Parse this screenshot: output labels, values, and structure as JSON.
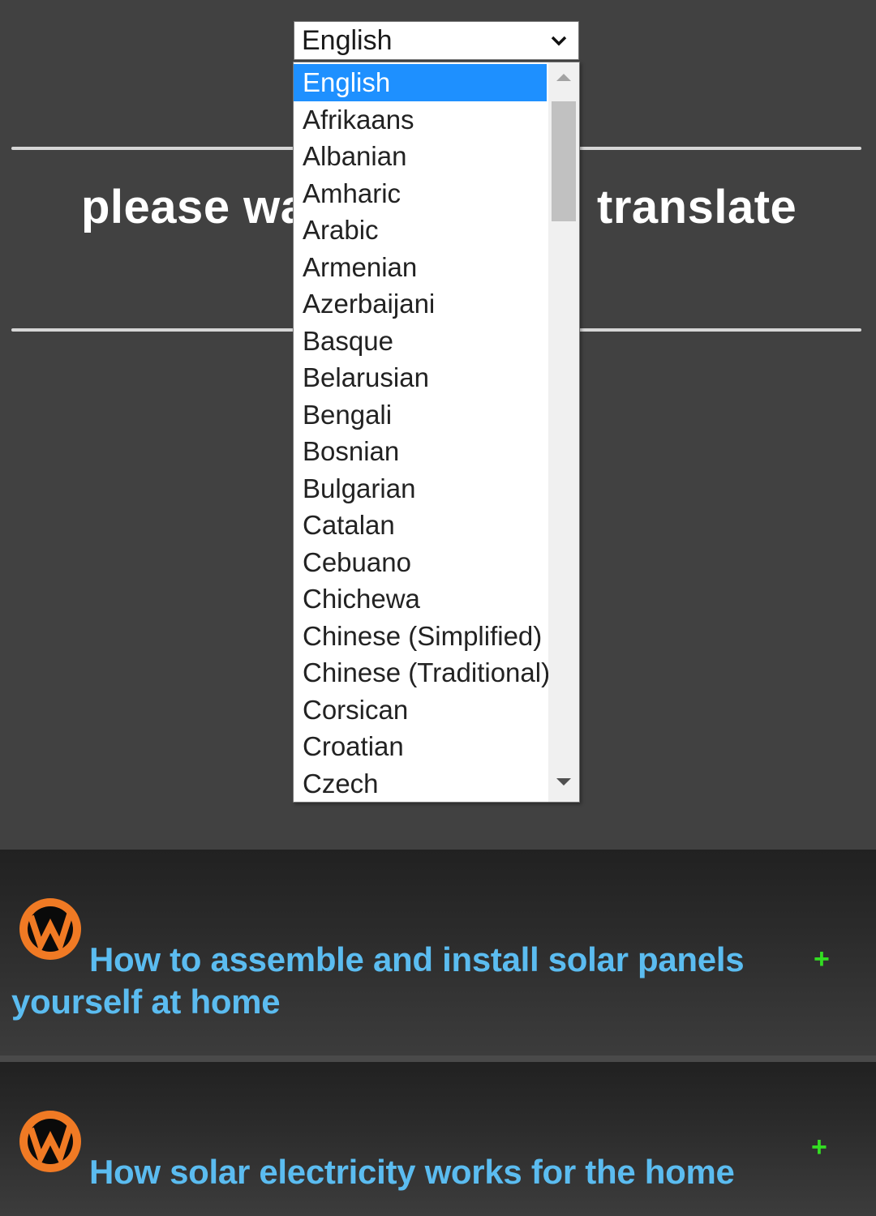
{
  "language_select": {
    "selected_value": "English",
    "options": [
      "English",
      "Afrikaans",
      "Albanian",
      "Amharic",
      "Arabic",
      "Armenian",
      "Azerbaijani",
      "Basque",
      "Belarusian",
      "Bengali",
      "Bosnian",
      "Bulgarian",
      "Catalan",
      "Cebuano",
      "Chichewa",
      "Chinese (Simplified)",
      "Chinese (Traditional)",
      "Corsican",
      "Croatian",
      "Czech"
    ],
    "highlighted_index": 0
  },
  "heading": {
    "visible_left": "please wa",
    "visible_right": "translate"
  },
  "articles": [
    {
      "title": "How to assemble and install solar panels yourself at home",
      "logo_icon": "w-logo-icon",
      "action_icon": "plus-icon",
      "action_label": "+"
    },
    {
      "title": "How solar electricity works for the home",
      "logo_icon": "w-logo-icon",
      "action_icon": "plus-icon",
      "action_label": "+"
    }
  ],
  "colors": {
    "background": "#414141",
    "selection": "#1e90ff",
    "link": "#5bbcf0",
    "plus": "#33dd22",
    "logo_orange": "#f07a24"
  }
}
